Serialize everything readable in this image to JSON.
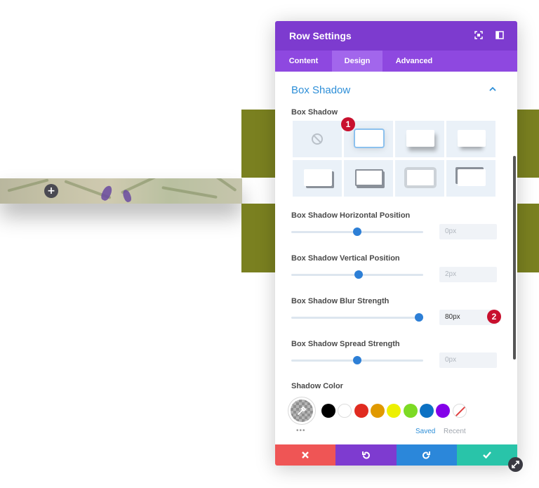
{
  "modal": {
    "title": "Row Settings",
    "tabs": [
      {
        "label": "Content",
        "active": false
      },
      {
        "label": "Design",
        "active": true
      },
      {
        "label": "Advanced",
        "active": false
      }
    ]
  },
  "section": {
    "title": "Box Shadow",
    "preset_label": "Box Shadow"
  },
  "badges": [
    "1",
    "2"
  ],
  "sliders": [
    {
      "label": "Box Shadow Horizontal Position",
      "value": "0px",
      "fraction": 0.5
    },
    {
      "label": "Box Shadow Vertical Position",
      "value": "2px",
      "fraction": 0.51
    },
    {
      "label": "Box Shadow Blur Strength",
      "value": "80px",
      "fraction": 0.97
    },
    {
      "label": "Box Shadow Spread Strength",
      "value": "0px",
      "fraction": 0.5
    }
  ],
  "shadow_color": {
    "label": "Shadow Color",
    "more": "•••",
    "swatches": [
      "#000000",
      "#ffffff",
      "#e02b20",
      "#e09900",
      "#edf000",
      "#7cda24",
      "#0c71c3",
      "#8300e9"
    ],
    "saved_label": "Saved",
    "recent_label": "Recent"
  },
  "colors": {
    "header": "#7d3bcf",
    "tabs": "#8e48e0",
    "accent": "#2e8fd8",
    "cancel": "#ef5555",
    "undo": "#7e3bd0",
    "redo": "#2b87da",
    "save": "#29c4a9",
    "badge": "#c8102e",
    "olive": "#7a8020"
  },
  "icons": {
    "header": [
      "expand-icon",
      "sidebar-icon"
    ],
    "footer": [
      "close-icon",
      "undo-icon",
      "redo-icon",
      "check-icon"
    ]
  }
}
